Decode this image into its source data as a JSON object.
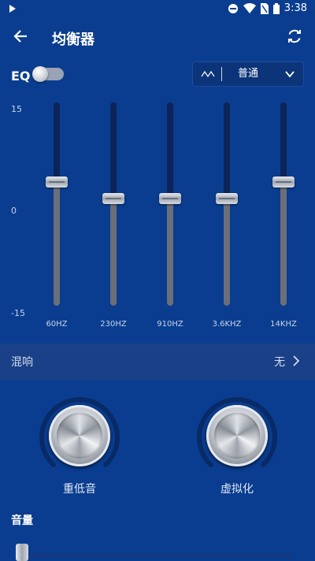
{
  "status_bar": {
    "time": "3:38"
  },
  "app_bar": {
    "title": "均衡器"
  },
  "eq": {
    "label": "EQ",
    "enabled": false,
    "preset": "普通",
    "scale_top": "15",
    "scale_mid": "0",
    "scale_bottom": "-15",
    "bands": [
      {
        "label": "60HZ",
        "gain_db": 3.2
      },
      {
        "label": "230HZ",
        "gain_db": 0.8
      },
      {
        "label": "910HZ",
        "gain_db": 0.8
      },
      {
        "label": "3.6KHZ",
        "gain_db": 0.8
      },
      {
        "label": "14KHZ",
        "gain_db": 3.2
      }
    ]
  },
  "reverb": {
    "label": "混响",
    "value": "无"
  },
  "knobs": {
    "bass_label": "重低音",
    "virtualizer_label": "虚拟化"
  },
  "volume": {
    "label": "音量",
    "level": 0.0
  },
  "colors": {
    "background": "#0a3d8f",
    "accent_arc": "#0b2f70"
  }
}
